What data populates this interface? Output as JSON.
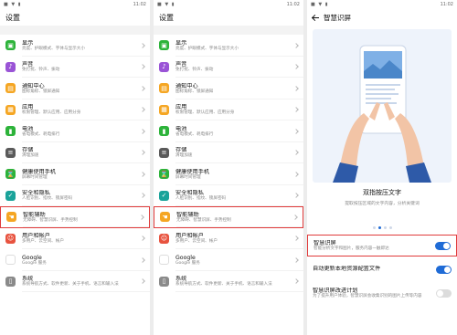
{
  "status": {
    "time": "11:02",
    "indicators": "■ ▼ ▮"
  },
  "panel1": {
    "title": "设置",
    "items": [
      {
        "title": "显示",
        "sub": "亮度、护眼模式、字体与显示大小",
        "icon": "display-icon",
        "color": "c-green",
        "glyph": "▣"
      },
      {
        "title": "声音",
        "sub": "免打扰、铃声、振动",
        "icon": "sound-icon",
        "color": "c-purple",
        "glyph": "♪"
      },
      {
        "title": "通知中心",
        "sub": "图标角标、锁屏通知",
        "icon": "notification-icon",
        "color": "c-orange",
        "glyph": "▤"
      },
      {
        "title": "应用",
        "sub": "权限管理、默认应用、应用分身",
        "icon": "apps-icon",
        "color": "c-orange",
        "glyph": "▦"
      },
      {
        "title": "电池",
        "sub": "省电模式、耗电排行",
        "icon": "battery-icon",
        "color": "c-green",
        "glyph": "▮"
      },
      {
        "title": "存储",
        "sub": "清理加速",
        "icon": "storage-icon",
        "color": "c-dark",
        "glyph": "≡"
      },
      {
        "title": "健康使用手机",
        "sub": "屏幕时间管理",
        "icon": "hourglass-icon",
        "color": "c-green",
        "glyph": "⌛"
      },
      {
        "title": "安全和隐私",
        "sub": "人脸识别、指纹、锁屏密码",
        "icon": "shield-icon",
        "color": "c-teal",
        "glyph": "✓"
      },
      {
        "title": "智能辅助",
        "sub": "无障碍、智慧识屏、手势控制",
        "icon": "hand-icon",
        "color": "c-orange",
        "glyph": "☚",
        "selected": true
      },
      {
        "title": "用户和帐户",
        "sub": "多用户、云空间、帐户",
        "icon": "user-icon",
        "color": "c-red",
        "glyph": "☺"
      },
      {
        "title": "Google",
        "sub": "Google 服务",
        "icon": "google-icon",
        "color": "c-ggl",
        "glyph": "G"
      },
      {
        "title": "系统",
        "sub": "系统导航方式、软件更新、关于手机、语言和输入法",
        "icon": "system-icon",
        "color": "c-grey",
        "glyph": "▯"
      }
    ]
  },
  "panel2": {
    "title": "设置",
    "items": [
      {
        "title": "显示",
        "sub": "亮度、护眼模式、字体与显示大小",
        "icon": "display-icon",
        "color": "c-green",
        "glyph": "▣"
      },
      {
        "title": "声音",
        "sub": "免打扰、铃声、振动",
        "icon": "sound-icon",
        "color": "c-purple",
        "glyph": "♪"
      },
      {
        "title": "通知中心",
        "sub": "图标角标、锁屏通知",
        "icon": "notification-icon",
        "color": "c-orange",
        "glyph": "▤"
      },
      {
        "title": "应用",
        "sub": "权限管理、默认应用、应用分身",
        "icon": "apps-icon",
        "color": "c-orange",
        "glyph": "▦"
      },
      {
        "title": "电池",
        "sub": "省电模式、耗电排行",
        "icon": "battery-icon",
        "color": "c-green",
        "glyph": "▮"
      },
      {
        "title": "存储",
        "sub": "清理加速",
        "icon": "storage-icon",
        "color": "c-dark",
        "glyph": "≡"
      },
      {
        "title": "健康使用手机",
        "sub": "屏幕时间管理",
        "icon": "hourglass-icon",
        "color": "c-green",
        "glyph": "⌛"
      },
      {
        "title": "安全和隐私",
        "sub": "人脸识别、指纹、锁屏密码",
        "icon": "shield-icon",
        "color": "c-teal",
        "glyph": "✓"
      },
      {
        "title": "智能辅助",
        "sub": "无障碍、智慧识屏、手势控制",
        "icon": "hand-icon",
        "color": "c-orange",
        "glyph": "☚",
        "selected": true
      },
      {
        "title": "用户和帐户",
        "sub": "多用户、云空间、帐户",
        "icon": "user-icon",
        "color": "c-red",
        "glyph": "☺"
      },
      {
        "title": "Google",
        "sub": "Google 服务",
        "icon": "google-icon",
        "color": "c-ggl",
        "glyph": "G"
      },
      {
        "title": "系统",
        "sub": "系统导航方式、软件更新、关于手机、语言和输入法",
        "icon": "system-icon",
        "color": "c-grey",
        "glyph": "▯"
      }
    ]
  },
  "panel3": {
    "title": "智慧识屏",
    "card_title": "双指按压文字",
    "card_sub": "提取按压区域的文字内容，分析关键词",
    "settings": [
      {
        "title": "智慧识屏",
        "sub": "智能分析文字和图片，服务内容一触即达",
        "on": true,
        "selected": true
      },
      {
        "title": "自动更新本地资源配置文件",
        "sub": "",
        "on": true
      },
      {
        "title": "智慧识屏改进计划",
        "sub": "为了提升用户体验，智慧识屏会收集识别的图片上传等内容",
        "on": false
      }
    ]
  }
}
